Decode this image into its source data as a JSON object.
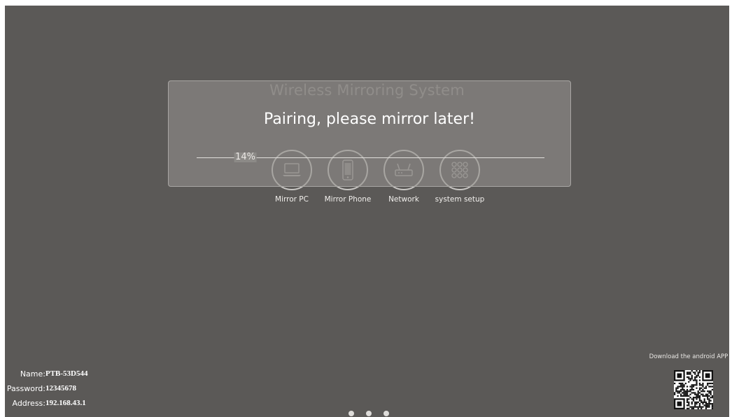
{
  "app": {
    "title": "Wireless Mirroring System"
  },
  "dialog": {
    "message": "Pairing, please mirror later!",
    "progress_percent": 14,
    "progress_label": "14%"
  },
  "menu": {
    "items": [
      {
        "label": "Mirror PC",
        "icon": "laptop-icon"
      },
      {
        "label": "Mirror Phone",
        "icon": "smartphone-icon"
      },
      {
        "label": "Network",
        "icon": "router-icon"
      },
      {
        "label": "system setup",
        "icon": "grid-icon"
      }
    ]
  },
  "device_info": {
    "name_label": "Name:",
    "name_value": "PTB-53D544",
    "password_label": "Password:",
    "password_value": "12345678",
    "address_label": "Address:",
    "address_value": "192.168.43.1"
  },
  "download": {
    "caption": "Download the android APP",
    "qr_icon": "qr-code-icon"
  },
  "pager": {
    "count": 3,
    "active_index": 0
  },
  "colors": {
    "background": "#5b5957",
    "modal": "#928f8c",
    "text": "#ffffff"
  }
}
